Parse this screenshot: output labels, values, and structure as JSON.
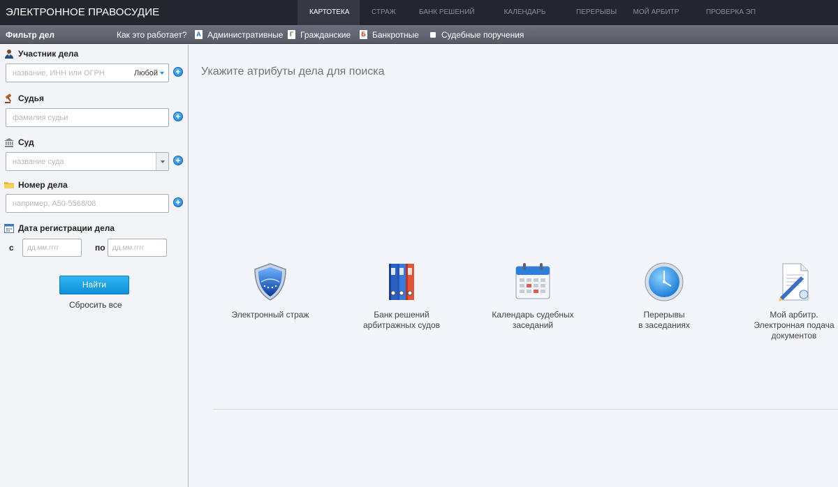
{
  "brand": "ЭЛЕКТРОННОЕ ПРАВОСУДИЕ",
  "topnav": [
    {
      "label": "КАРТОТЕКА",
      "active": true
    },
    {
      "label": "СТРАЖ",
      "active": false
    },
    {
      "label": "БАНК РЕШЕНИЙ",
      "active": false
    },
    {
      "label": "КАЛЕНДАРЬ",
      "active": false
    },
    {
      "label": "ПЕРЕРЫВЫ",
      "active": false
    },
    {
      "label": "МОЙ АРБИТР",
      "active": false
    },
    {
      "label": "ПРОВЕРКА ЭП",
      "active": false
    }
  ],
  "filterbar": {
    "title": "Фильтр дел",
    "how_link": "Как это работает?",
    "categories": [
      {
        "letter": "А",
        "label": "Административные"
      },
      {
        "letter": "Г",
        "label": "Гражданские"
      },
      {
        "letter": "Б",
        "label": "Банкротные"
      },
      {
        "letter": "",
        "label": "Судебные поручения"
      }
    ]
  },
  "sidebar": {
    "participant": {
      "label": "Участник дела",
      "placeholder": "название, ИНН или ОГРН",
      "select_value": "Любой",
      "icon": "person-icon"
    },
    "judge": {
      "label": "Судья",
      "placeholder": "фамилия судьи",
      "icon": "gavel-icon"
    },
    "court": {
      "label": "Суд",
      "placeholder": "название суда",
      "icon": "courthouse-icon"
    },
    "case_number": {
      "label": "Номер дела",
      "placeholder": "например, А50-5568/08",
      "icon": "folder-icon"
    },
    "reg_date": {
      "label": "Дата регистрации дела",
      "from_label": "с",
      "to_label": "по",
      "from_placeholder": "дд.мм.гггг",
      "to_placeholder": "дд.мм.гггг",
      "icon": "calendar-icon"
    },
    "find_button": "Найти",
    "reset_link": "Сбросить все"
  },
  "main": {
    "hint": "Укажите атрибуты дела для поиска",
    "services": [
      {
        "label": "Электронный страж",
        "icon": "shield-icon"
      },
      {
        "label": "Банк решений\nарбитражных судов",
        "icon": "binders-icon"
      },
      {
        "label": "Календарь судебных\nзаседаний",
        "icon": "calendar-icon"
      },
      {
        "label": "Перерывы\nв заседаниях",
        "icon": "clock-icon"
      },
      {
        "label": "Мой арбитр.\nЭлектронная подача\nдокументов",
        "icon": "document-pen-icon"
      }
    ]
  },
  "colors": {
    "topbar": "#24262f",
    "accent_blue": "#1b8fd8",
    "active_tab": "#363944"
  }
}
